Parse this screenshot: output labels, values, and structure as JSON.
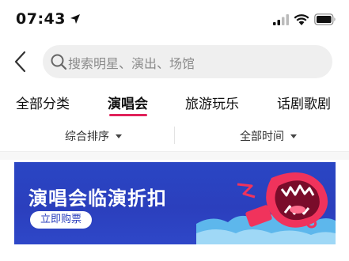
{
  "status_bar": {
    "time": "07:43"
  },
  "search": {
    "placeholder": "搜索明星、演出、场馆"
  },
  "tabs": [
    {
      "label": "全部分类"
    },
    {
      "label": "演唱会"
    },
    {
      "label": "旅游玩乐"
    },
    {
      "label": "话剧歌剧"
    }
  ],
  "active_tab": "演唱会",
  "sort": {
    "order_label": "综合排序",
    "time_label": "全部时间"
  },
  "banner": {
    "title": "演唱会临演折扣",
    "button_label": "立即购票"
  },
  "colors": {
    "accent": "#e0225a",
    "banner_bg": "#2b3fbd"
  },
  "icons": [
    "location-arrow-icon",
    "cellular-signal-icon",
    "wifi-icon",
    "battery-icon",
    "back-chevron-icon",
    "search-icon",
    "caret-down-icon"
  ]
}
